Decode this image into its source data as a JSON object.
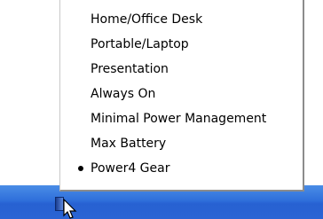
{
  "menu": {
    "items": [
      {
        "label": "Home/Office Desk",
        "selected": false
      },
      {
        "label": "Portable/Laptop",
        "selected": false
      },
      {
        "label": "Presentation",
        "selected": false
      },
      {
        "label": "Always On",
        "selected": false
      },
      {
        "label": "Minimal Power Management",
        "selected": false
      },
      {
        "label": "Max Battery",
        "selected": false
      },
      {
        "label": "Power4 Gear",
        "selected": true
      }
    ]
  },
  "icons": {
    "tray": "power-gear-tray-icon",
    "cursor": "mouse-pointer-icon",
    "selection": "bullet-icon"
  },
  "colors": {
    "taskbar": "#2f6fdb",
    "menu_background": "#ffffff",
    "text": "#000000"
  }
}
